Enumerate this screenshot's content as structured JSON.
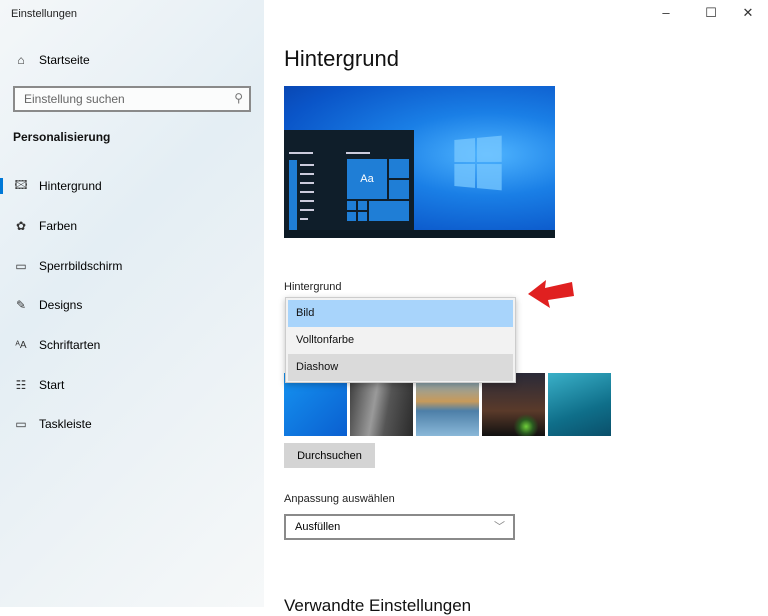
{
  "window": {
    "title": "Einstellungen",
    "minimize_icon": "minimize-icon",
    "maximize_icon": "maximize-icon",
    "close_icon": "close-icon"
  },
  "sidebar": {
    "home": {
      "label": "Startseite",
      "icon": "home-icon"
    },
    "search": {
      "placeholder": "Einstellung suchen",
      "icon": "search-icon"
    },
    "section": "Personalisierung",
    "items": [
      {
        "label": "Hintergrund",
        "icon": "picture-icon",
        "active": true
      },
      {
        "label": "Farben",
        "icon": "palette-icon"
      },
      {
        "label": "Sperrbildschirm",
        "icon": "lock-screen-icon"
      },
      {
        "label": "Designs",
        "icon": "brush-icon"
      },
      {
        "label": "Schriftarten",
        "icon": "font-icon"
      },
      {
        "label": "Start",
        "icon": "start-icon"
      },
      {
        "label": "Taskleiste",
        "icon": "taskbar-icon"
      }
    ]
  },
  "main": {
    "title": "Hintergrund",
    "preview_text": "Aa",
    "background_label": "Hintergrund",
    "background_options": [
      "Bild",
      "Volltonfarbe",
      "Diashow"
    ],
    "selected_option": "Bild",
    "browse_label": "Durchsuchen",
    "fit_label": "Anpassung auswählen",
    "fit_value": "Ausfüllen",
    "related_heading": "Verwandte Einstellungen",
    "accent_color": "#0078d7",
    "annotation_color": "#e02020"
  }
}
